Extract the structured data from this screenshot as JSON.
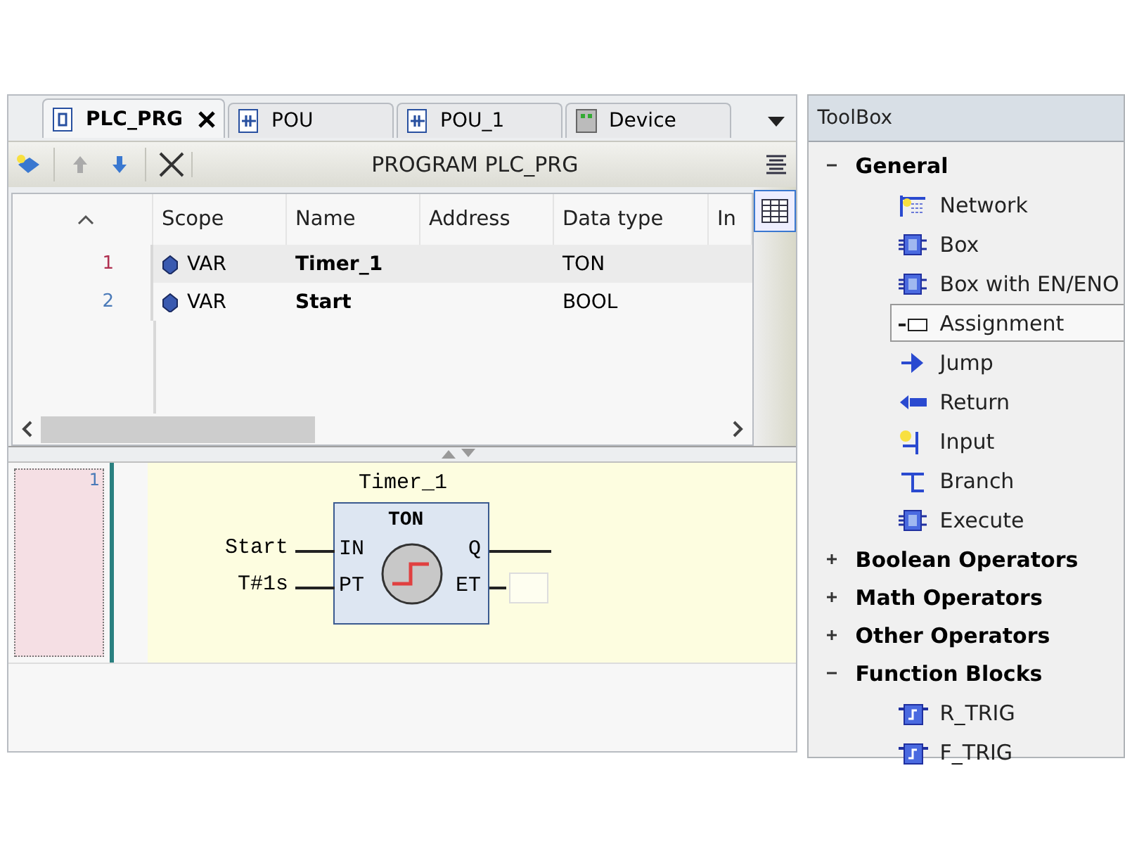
{
  "tabs": [
    {
      "label": "PLC_PRG",
      "selected": true,
      "kind": "program"
    },
    {
      "label": "POU",
      "selected": false,
      "kind": "pou"
    },
    {
      "label": "POU_1",
      "selected": false,
      "kind": "pou"
    },
    {
      "label": "Device",
      "selected": false,
      "kind": "device"
    }
  ],
  "toolbar": {
    "title": "PROGRAM PLC_PRG"
  },
  "declarations": {
    "columns": [
      "Scope",
      "Name",
      "Address",
      "Data type",
      "In"
    ],
    "rows": [
      {
        "line": "1",
        "scope": "VAR",
        "name": "Timer_1",
        "address": "",
        "type": "TON",
        "selected": true
      },
      {
        "line": "2",
        "scope": "VAR",
        "name": "Start",
        "address": "",
        "type": "BOOL",
        "selected": false
      }
    ]
  },
  "network": {
    "number": "1",
    "instance": "Timer_1",
    "block": "TON",
    "inputs": [
      {
        "pin": "IN",
        "variable": "Start"
      },
      {
        "pin": "PT",
        "variable": "T#1s"
      }
    ],
    "outputs": [
      {
        "pin": "Q",
        "kind": "line"
      },
      {
        "pin": "ET",
        "kind": "box"
      }
    ]
  },
  "toolbox": {
    "title": "ToolBox",
    "groups": [
      {
        "label": "General",
        "expanded": true,
        "items": [
          {
            "label": "Network",
            "kind": "network",
            "selected": false
          },
          {
            "label": "Box",
            "kind": "box",
            "selected": false
          },
          {
            "label": "Box with EN/ENO",
            "kind": "box",
            "selected": false
          },
          {
            "label": "Assignment",
            "kind": "assignment",
            "selected": true
          },
          {
            "label": "Jump",
            "kind": "jump",
            "selected": false
          },
          {
            "label": "Return",
            "kind": "return",
            "selected": false
          },
          {
            "label": "Input",
            "kind": "input",
            "selected": false
          },
          {
            "label": "Branch",
            "kind": "branch",
            "selected": false
          },
          {
            "label": "Execute",
            "kind": "box",
            "selected": false
          }
        ]
      },
      {
        "label": "Boolean Operators",
        "expanded": false
      },
      {
        "label": "Math Operators",
        "expanded": false
      },
      {
        "label": "Other Operators",
        "expanded": false
      },
      {
        "label": "Function Blocks",
        "expanded": true,
        "items": [
          {
            "label": "R_TRIG",
            "kind": "fb",
            "selected": false
          },
          {
            "label": "F_TRIG",
            "kind": "fb",
            "selected": false
          }
        ]
      }
    ]
  }
}
